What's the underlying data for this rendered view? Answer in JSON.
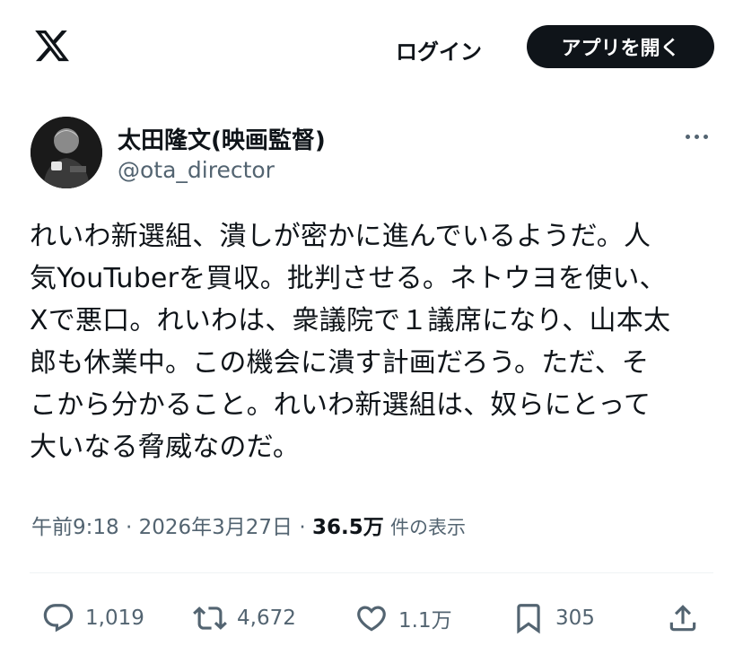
{
  "header": {
    "logo_icon": "x-logo-icon",
    "login_label": "ログイン",
    "open_app_label": "アプリを開く"
  },
  "tweet": {
    "author": {
      "display_name": "太田隆文(映画監督)",
      "handle": "@ota_director",
      "avatar_icon": "avatar-photo"
    },
    "more_icon": "more-dots-icon",
    "text": "れいわ新選組、潰しが密かに進んでいるようだ。人\n気YouTuberを買収。批判させる。ネトウヨを使い、\nXで悪口。れいわは、衆議院で１議席になり、山本太\n郎も休業中。この機会に潰す計画だろう。ただ、そ\nこから分かること。れいわ新選組は、奴らにとって\n大いなる脅威なのだ。",
    "time": "午前9:18",
    "separator": "·",
    "date": "2026年3月27日",
    "views_count": "36.5万",
    "views_label": "件の表示"
  },
  "actions": {
    "reply": {
      "icon": "reply-bubble-icon",
      "count": "1,019"
    },
    "retweet": {
      "icon": "retweet-icon",
      "count": "4,672"
    },
    "like": {
      "icon": "heart-icon",
      "count": "1.1万"
    },
    "bookmark": {
      "icon": "bookmark-icon",
      "count": "305"
    },
    "share": {
      "icon": "share-upload-icon"
    }
  },
  "colors": {
    "text_primary": "#0f1419",
    "text_secondary": "#536471",
    "divider": "#eff3f4",
    "button_bg": "#0f1419",
    "button_text": "#ffffff"
  }
}
